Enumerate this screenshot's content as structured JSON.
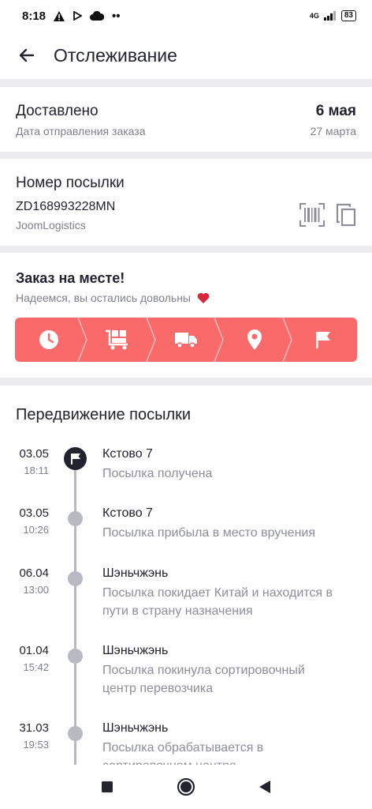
{
  "status_bar": {
    "time": "8:18",
    "network": "4G",
    "battery": "83"
  },
  "header": {
    "title": "Отслеживание"
  },
  "delivery_status": {
    "status": "Доставлено",
    "status_caption": "Дата отправления заказа",
    "delivered_date": "6 мая",
    "sent_date": "27 марта"
  },
  "parcel": {
    "heading": "Номер посылки",
    "tracking_number": "ZD168993228MN",
    "carrier": "JoomLogistics",
    "barcode_icon": "barcode-icon",
    "copy_icon": "copy-icon"
  },
  "arrival": {
    "heading": "Заказ на месте!",
    "message": "Надеемся, вы остались довольны",
    "heart_icon": "heart-icon",
    "steps": [
      "clock-icon",
      "warehouse-cart-icon",
      "truck-icon",
      "location-pin-icon",
      "flag-icon"
    ],
    "color": "#fb6a6a"
  },
  "movement": {
    "heading": "Передвижение посылки",
    "events": [
      {
        "date": "03.05",
        "time": "18:11",
        "place": "Кстово 7",
        "description": "Посылка получена"
      },
      {
        "date": "03.05",
        "time": "10:26",
        "place": "Кстово 7",
        "description": "Посылка прибыла в место вручения"
      },
      {
        "date": "06.04",
        "time": "13:00",
        "place": "Шэньчжэнь",
        "description": "Посылка покидает Китай и находится в пути в страну назначения"
      },
      {
        "date": "01.04",
        "time": "15:42",
        "place": "Шэньчжэнь",
        "description": "Посылка покинула сортировочный центр перевозчика"
      },
      {
        "date": "31.03",
        "time": "19:53",
        "place": "Шэньчжэнь",
        "description": "Посылка обрабатывается в сортировочном центре"
      }
    ]
  }
}
